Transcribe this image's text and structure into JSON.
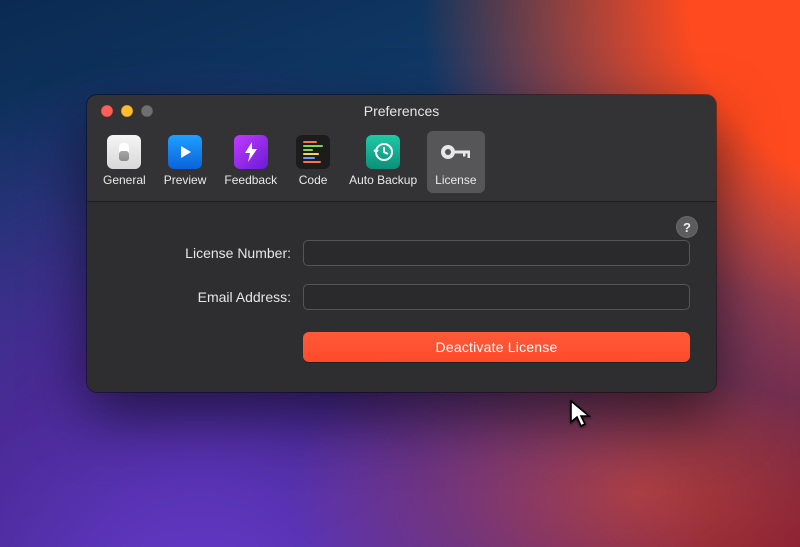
{
  "window": {
    "title": "Preferences"
  },
  "tabs": [
    {
      "id": "general",
      "label": "General"
    },
    {
      "id": "preview",
      "label": "Preview"
    },
    {
      "id": "feedback",
      "label": "Feedback"
    },
    {
      "id": "code",
      "label": "Code"
    },
    {
      "id": "backup",
      "label": "Auto Backup"
    },
    {
      "id": "license",
      "label": "License",
      "active": true
    }
  ],
  "form": {
    "license_number": {
      "label": "License Number:",
      "value": ""
    },
    "email": {
      "label": "Email Address:",
      "value": ""
    },
    "action_label": "Deactivate License"
  },
  "help_glyph": "?"
}
